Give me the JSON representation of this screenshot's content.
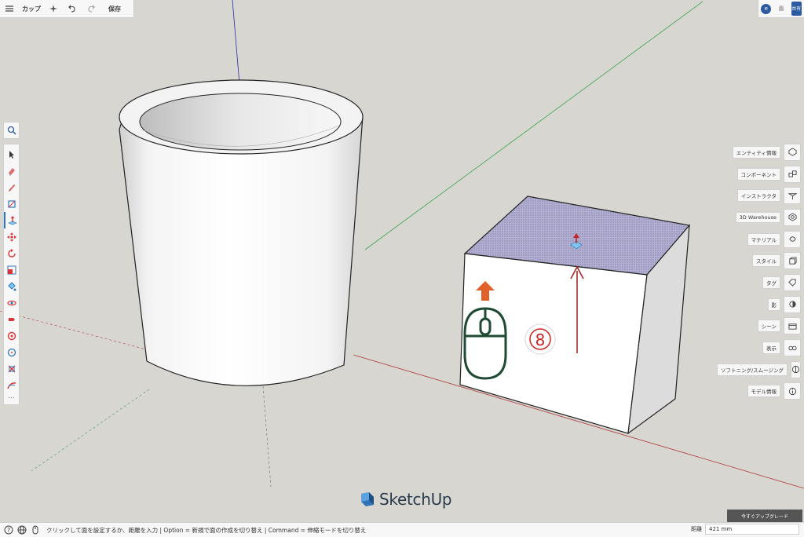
{
  "toolbar": {
    "menu_icon": "hamburger-menu-icon",
    "title": "カップ",
    "save_label": "保存"
  },
  "top_right": {
    "avatar_letter": "e",
    "share_label": "共有"
  },
  "left_tools": [
    "select-icon",
    "eraser-icon",
    "pencil-icon",
    "rectangle-icon",
    "push-pull-icon",
    "move-icon",
    "rotate-icon",
    "scale-icon",
    "paint-bucket-icon",
    "orbit-icon",
    "tape-measure-icon",
    "section-plane-icon",
    "circle-icon",
    "offset-icon",
    "follow-me-icon"
  ],
  "right_panel": [
    {
      "label": "エンティティ情報",
      "icon": "entity-info-icon"
    },
    {
      "label": "コンポーネント",
      "icon": "components-icon"
    },
    {
      "label": "インストラクタ",
      "icon": "instructor-icon"
    },
    {
      "label": "3D Warehouse",
      "icon": "warehouse-icon"
    },
    {
      "label": "マテリアル",
      "icon": "materials-icon"
    },
    {
      "label": "スタイル",
      "icon": "styles-icon"
    },
    {
      "label": "タグ",
      "icon": "tags-icon"
    },
    {
      "label": "影",
      "icon": "shadows-icon"
    },
    {
      "label": "シーン",
      "icon": "scenes-icon"
    },
    {
      "label": "表示",
      "icon": "display-icon"
    },
    {
      "label": "ソフトニング/スムージング",
      "icon": "soften-smooth-icon"
    },
    {
      "label": "モデル情報",
      "icon": "model-info-icon"
    }
  ],
  "upgrade_label": "今すぐアップグレード",
  "status": {
    "message": "クリックして面を設定するか、距離を入力 | Option = 新規で面の作成を切り替え | Command = 伸縮モードを切り替え",
    "measure_label": "距離",
    "measure_value": "421 mm"
  },
  "overlay": {
    "step_number": "8"
  },
  "logo_text": "SketchUp",
  "colors": {
    "accent": "#2c5aa0",
    "face_selected": "#a7a3c9",
    "arrow_red": "#a32a2a",
    "mouse_green": "#1f4a33",
    "arrow_orange": "#e0622a"
  }
}
